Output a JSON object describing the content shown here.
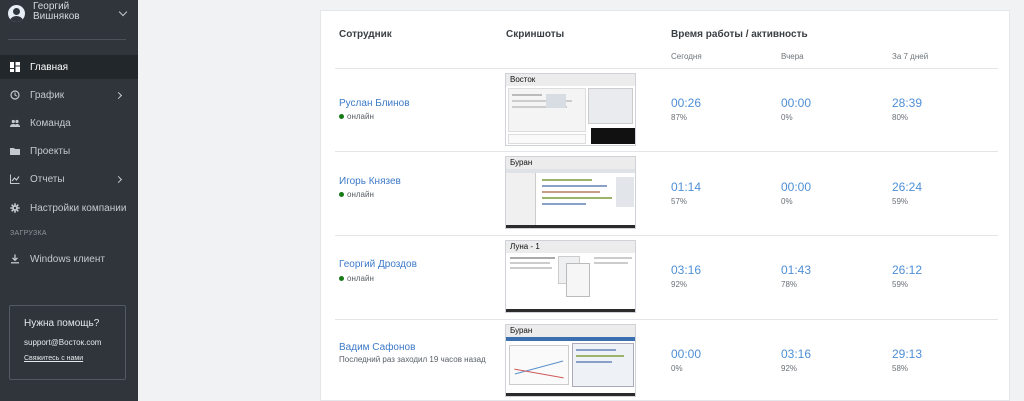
{
  "sidebar": {
    "user_name": "Георгий Вишняков",
    "nav": [
      {
        "label": "Главная",
        "icon": "dashboard-icon",
        "active": true
      },
      {
        "label": "График",
        "icon": "clock-icon",
        "has_submenu": true
      },
      {
        "label": "Команда",
        "icon": "team-icon"
      },
      {
        "label": "Проекты",
        "icon": "folder-icon"
      },
      {
        "label": "Отчеты",
        "icon": "chart-icon",
        "has_submenu": true
      },
      {
        "label": "Настройки компании",
        "icon": "gear-icon"
      }
    ],
    "section_label": "ЗАГРУЗКА",
    "download_item": {
      "label": "Windows клиент",
      "icon": "download-icon"
    },
    "help": {
      "title": "Нужна помощь?",
      "email": "support@Восток.com",
      "link": "Свяжитесь с нами"
    }
  },
  "table": {
    "headers": {
      "employee": "Сотрудник",
      "screenshots": "Скриншоты",
      "activity": "Время работы / активность",
      "today": "Сегодня",
      "yesterday": "Вчера",
      "week": "За 7 дней"
    },
    "rows": [
      {
        "name": "Руслан Блинов",
        "status": "онлайн",
        "online": true,
        "screenshot_title": "Восток",
        "today": {
          "time": "00:26",
          "pct": "87%"
        },
        "yesterday": {
          "time": "00:00",
          "pct": "0%"
        },
        "week": {
          "time": "28:39",
          "pct": "80%"
        }
      },
      {
        "name": "Игорь Князев",
        "status": "онлайн",
        "online": true,
        "screenshot_title": "Буран",
        "today": {
          "time": "01:14",
          "pct": "57%"
        },
        "yesterday": {
          "time": "00:00",
          "pct": "0%"
        },
        "week": {
          "time": "26:24",
          "pct": "59%"
        }
      },
      {
        "name": "Георгий Дроздов",
        "status": "онлайн",
        "online": true,
        "screenshot_title": "Луна - 1",
        "today": {
          "time": "03:16",
          "pct": "92%"
        },
        "yesterday": {
          "time": "01:43",
          "pct": "78%"
        },
        "week": {
          "time": "26:12",
          "pct": "59%"
        }
      },
      {
        "name": "Вадим Сафонов",
        "status": "Последний раз заходил 19 часов назад",
        "online": false,
        "screenshot_title": "Буран",
        "today": {
          "time": "00:00",
          "pct": "0%"
        },
        "yesterday": {
          "time": "03:16",
          "pct": "92%"
        },
        "week": {
          "time": "29:13",
          "pct": "58%"
        }
      }
    ]
  }
}
